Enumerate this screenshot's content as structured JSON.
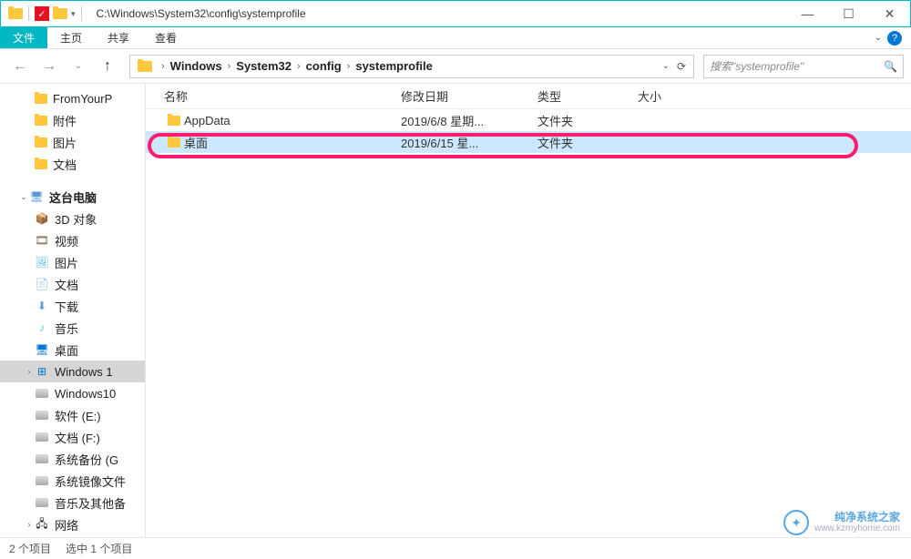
{
  "title": "C:\\Windows\\System32\\config\\systemprofile",
  "ribbon": {
    "file": "文件",
    "home": "主页",
    "share": "共享",
    "view": "查看"
  },
  "breadcrumb": {
    "items": [
      "Windows",
      "System32",
      "config",
      "systemprofile"
    ]
  },
  "search": {
    "placeholder": "搜索\"systemprofile\""
  },
  "sidebar": {
    "items": [
      {
        "label": "FromYourP",
        "icon": "folder",
        "indent": 2
      },
      {
        "label": "附件",
        "icon": "folder",
        "indent": 2
      },
      {
        "label": "图片",
        "icon": "folder",
        "indent": 2
      },
      {
        "label": "文档",
        "icon": "folder",
        "indent": 2
      }
    ],
    "pc_label": "这台电脑",
    "pc_items": [
      {
        "label": "3D 对象",
        "icon": "3d"
      },
      {
        "label": "视频",
        "icon": "video"
      },
      {
        "label": "图片",
        "icon": "pic"
      },
      {
        "label": "文档",
        "icon": "doc"
      },
      {
        "label": "下载",
        "icon": "down"
      },
      {
        "label": "音乐",
        "icon": "music"
      },
      {
        "label": "桌面",
        "icon": "desk"
      },
      {
        "label": "Windows 1",
        "icon": "win",
        "caret": true,
        "selected": true
      },
      {
        "label": "Windows10",
        "icon": "disk"
      },
      {
        "label": "软件 (E:)",
        "icon": "disk"
      },
      {
        "label": "文档 (F:)",
        "icon": "disk"
      },
      {
        "label": "系统备份 (G",
        "icon": "disk"
      },
      {
        "label": "系统镜像文件",
        "icon": "disk"
      },
      {
        "label": "音乐及其他备",
        "icon": "disk"
      },
      {
        "label": "网络",
        "icon": "net",
        "caret": true
      }
    ]
  },
  "columns": {
    "name": "名称",
    "date": "修改日期",
    "type": "类型",
    "size": "大小"
  },
  "rows": [
    {
      "name": "AppData",
      "date": "2019/6/8 星期...",
      "type": "文件夹",
      "size": ""
    },
    {
      "name": "桌面",
      "date": "2019/6/15 星...",
      "type": "文件夹",
      "size": "",
      "selected": true
    }
  ],
  "status": {
    "count": "2 个项目",
    "selected": "选中 1 个项目"
  },
  "watermark": {
    "title": "纯净系统之家",
    "url": "www.kzmyhome.com"
  }
}
